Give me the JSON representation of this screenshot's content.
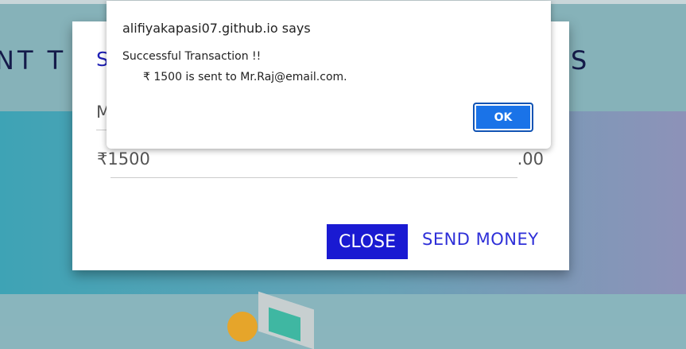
{
  "background": {
    "header_left_text": "NT T",
    "header_right_text": "S"
  },
  "modal": {
    "title_partial": "S",
    "field_label_partial": "M",
    "amount_prefix": "₹1500",
    "amount_suffix": ".00",
    "close_label": "CLOSE",
    "send_label": "SEND MONEY"
  },
  "alert": {
    "title": "alifiyakapasi07.github.io says",
    "line1": "Successful Transaction !!",
    "line2": "₹ 1500 is sent to Mr.Raj@email.com.",
    "ok_label": "OK"
  },
  "colors": {
    "primary": "#1a1ad2",
    "link": "#2e2fd8",
    "dialog_button": "#1a73e8"
  }
}
